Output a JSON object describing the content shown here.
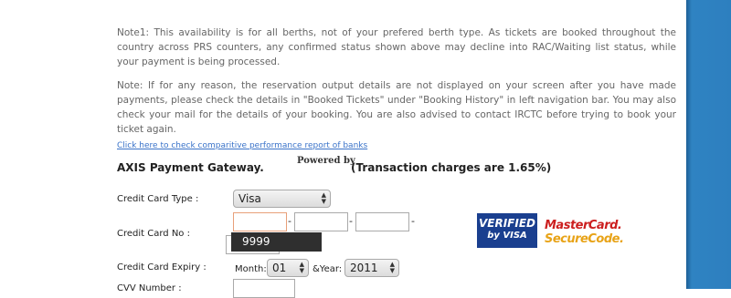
{
  "notes": {
    "note1": "Note1: This availability is for all berths, not of your prefered berth type. As tickets are booked throughout the country across PRS counters, any confirmed status shown above may decline into RAC/Waiting list status, while your payment is being processed.",
    "note2": "Note: If for any reason, the reservation output details are not displayed on your screen after you have made payments, please check the details in \"Booked Tickets\" under \"Booking History\" in left navigation bar. You may also check your mail for the details of your booking. You are also advised to contact IRCTC before trying to book your ticket again."
  },
  "perf_link": "Click here to check comparitive performance report of banks",
  "gateway": {
    "title": "AXIS Payment Gateway.",
    "powered_by": "Powered by",
    "charges": "(Transaction charges are 1.65%)"
  },
  "form": {
    "card_type_label": "Credit Card Type :",
    "card_type_value": "Visa",
    "card_no_label": "Credit Card No :",
    "card_no_dash": "-",
    "autocomplete_suggestion": "9999",
    "expiry_label": "Credit Card Expiry :",
    "month_label": "Month:",
    "month_value": "01",
    "year_label": "&Year:",
    "year_value": "2011",
    "cvv_label": "CVV Number :"
  },
  "logos": {
    "verified_by_visa_line1": "VERIFIED",
    "verified_by_visa_line2": "by VISA",
    "mastercard_line1": "MasterCard.",
    "mastercard_line2": "SecureCode."
  },
  "colors": {
    "right_panel": "#2d7fbf",
    "link": "#3a73c9",
    "focus_border": "#e8a07a"
  }
}
